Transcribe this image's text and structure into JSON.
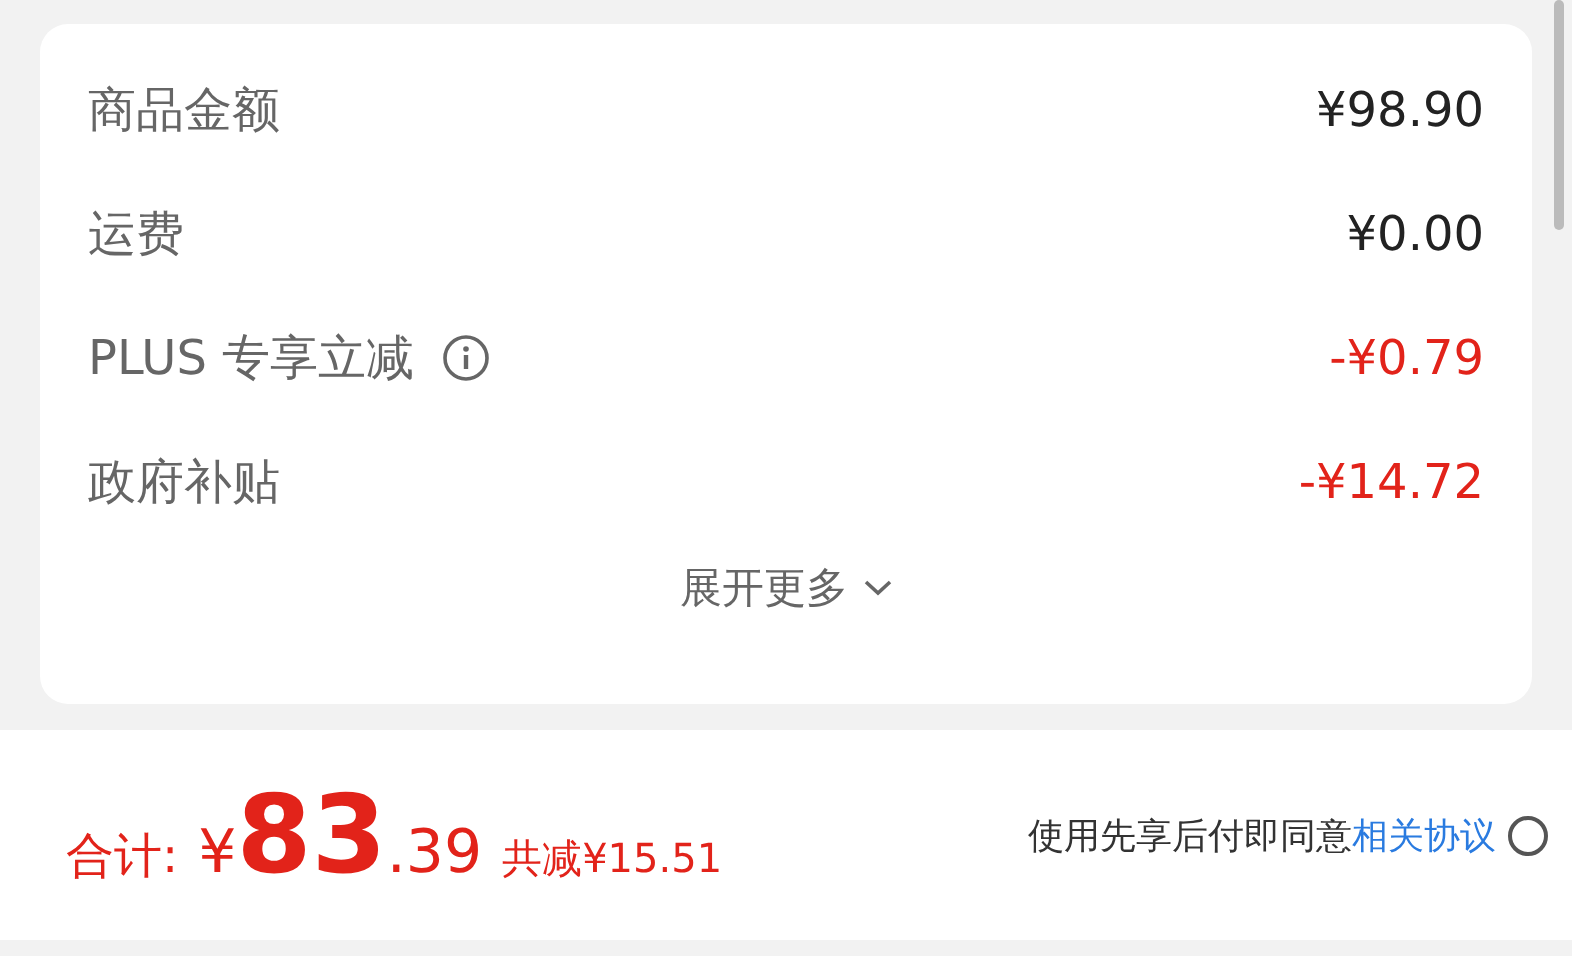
{
  "summary": {
    "rows": [
      {
        "label": "商品金额",
        "value": "¥98.90",
        "kind": "normal",
        "info": false
      },
      {
        "label": "运费",
        "value": "¥0.00",
        "kind": "normal",
        "info": false
      },
      {
        "label": "PLUS 专享立减",
        "value": "-¥0.79",
        "kind": "discount",
        "info": true
      },
      {
        "label": "政府补贴",
        "value": "-¥14.72",
        "kind": "discount",
        "info": false
      }
    ],
    "expand": "展开更多"
  },
  "footer": {
    "total_label": "合计:",
    "currency": "¥",
    "integer": "83",
    "decimal": ".39",
    "savings": "共减¥15.51",
    "agreement": {
      "text": "使用先享后付即同意",
      "link": "相关协议",
      "checked": false
    }
  }
}
